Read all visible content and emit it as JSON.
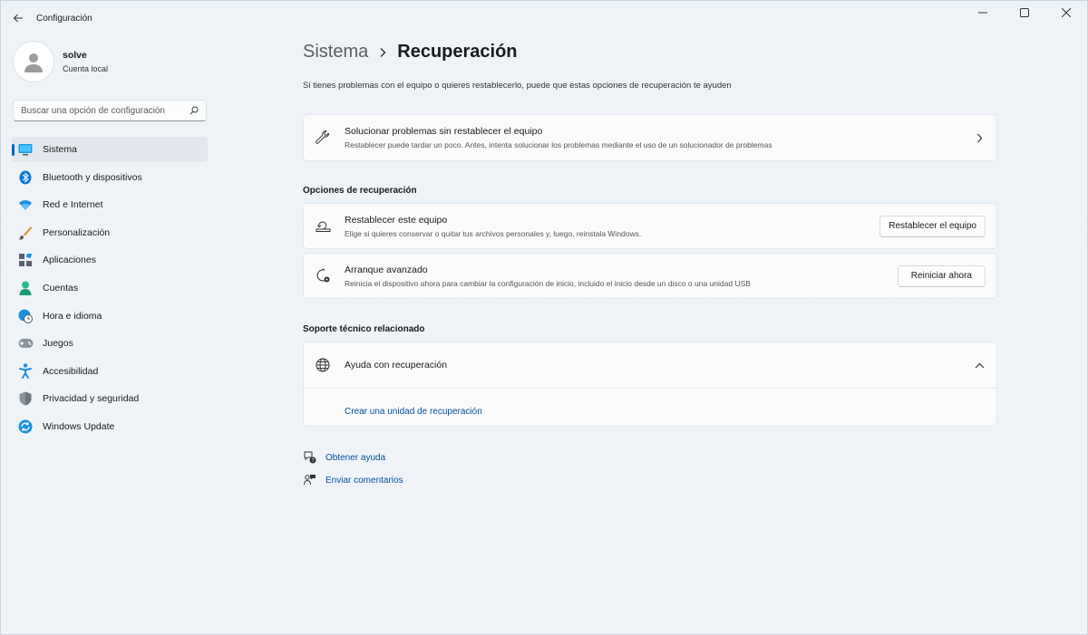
{
  "window": {
    "title": "Configuración"
  },
  "profile": {
    "name": "solve",
    "account_type": "Cuenta local"
  },
  "search": {
    "placeholder": "Buscar una opción de configuración"
  },
  "sidebar": {
    "items": [
      {
        "label": "Sistema",
        "icon": "system-icon",
        "active": true
      },
      {
        "label": "Bluetooth y dispositivos",
        "icon": "bluetooth-icon"
      },
      {
        "label": "Red e Internet",
        "icon": "wifi-icon"
      },
      {
        "label": "Personalización",
        "icon": "brush-icon"
      },
      {
        "label": "Aplicaciones",
        "icon": "apps-icon"
      },
      {
        "label": "Cuentas",
        "icon": "person-icon"
      },
      {
        "label": "Hora e idioma",
        "icon": "globe-clock-icon"
      },
      {
        "label": "Juegos",
        "icon": "gamepad-icon"
      },
      {
        "label": "Accesibilidad",
        "icon": "accessibility-icon"
      },
      {
        "label": "Privacidad y seguridad",
        "icon": "shield-icon"
      },
      {
        "label": "Windows Update",
        "icon": "update-icon"
      }
    ]
  },
  "breadcrumb": {
    "parent": "Sistema",
    "current": "Recuperación"
  },
  "main": {
    "subtitle": "Si tienes problemas con el equipo o quieres restablecerlo, puede que estas opciones de recuperación te ayuden",
    "troubleshoot": {
      "title": "Solucionar problemas sin restablecer el equipo",
      "desc": "Restablecer puede tardar un poco. Antes, intenta solucionar los problemas mediante el uso de un solucionador de problemas"
    },
    "recovery_section_title": "Opciones de recuperación",
    "reset": {
      "title": "Restablecer este equipo",
      "desc": "Elige si quieres conservar o quitar tus archivos personales y, luego, reinstala Windows.",
      "button": "Restablecer el equipo"
    },
    "advanced": {
      "title": "Arranque avanzado",
      "desc": "Reinicia el dispositivo ahora para cambiar la configuración de inicio, incluido el inicio desde un disco o una unidad USB",
      "button": "Reiniciar ahora"
    },
    "support_section_title": "Soporte técnico relacionado",
    "help": {
      "title": "Ayuda con recuperación",
      "link": "Crear una unidad de recuperación"
    }
  },
  "footer": {
    "get_help": "Obtener ayuda",
    "feedback": "Enviar comentarios"
  },
  "colors": {
    "accent": "#0067c0",
    "link": "#004e9a",
    "background": "#eef3f9",
    "card": "#fbfbfc"
  }
}
